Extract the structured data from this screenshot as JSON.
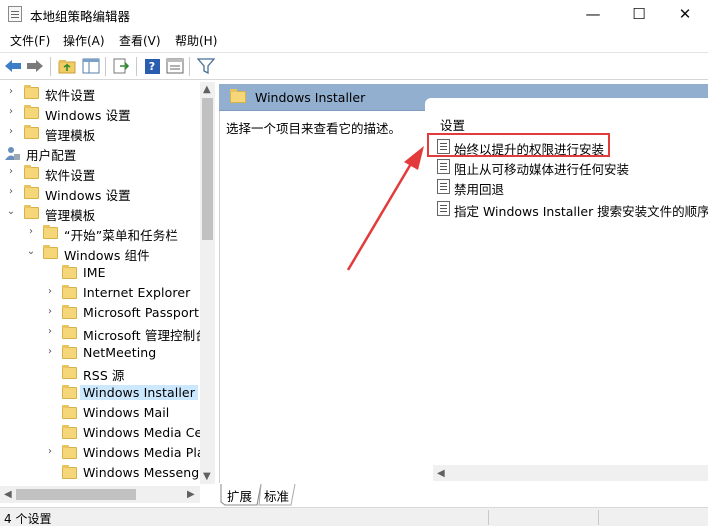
{
  "window": {
    "title": "本地组策略编辑器",
    "minimize_glyph": "—",
    "maximize_glyph": "☐",
    "close_glyph": "✕"
  },
  "menu": [
    "文件(F)",
    "操作(A)",
    "查看(V)",
    "帮助(H)"
  ],
  "toolbar": {
    "icons": [
      "back-arrow-icon",
      "forward-arrow-icon",
      "up-folder-icon",
      "show-hide-tree-icon",
      "export-list-icon",
      "help-icon",
      "properties-icon",
      "filter-icon"
    ],
    "help_glyph": "?"
  },
  "tree": {
    "items": [
      {
        "label": "软件设置",
        "expander": "›"
      },
      {
        "label": "Windows 设置",
        "expander": "›"
      },
      {
        "label": "管理模板",
        "expander": "›"
      },
      {
        "label": "用户配置",
        "expander": "⌄"
      },
      {
        "label": "软件设置",
        "expander": "›"
      },
      {
        "label": "Windows 设置",
        "expander": "›"
      },
      {
        "label": "管理模板",
        "expander": "⌄"
      },
      {
        "label": "“开始”菜单和任务栏",
        "expander": "›"
      },
      {
        "label": "Windows 组件",
        "expander": "⌄"
      },
      {
        "label": "IME",
        "expander": ""
      },
      {
        "label": "Internet Explorer",
        "expander": "›"
      },
      {
        "label": "Microsoft Passport",
        "expander": "›"
      },
      {
        "label": "Microsoft 管理控制台",
        "expander": "›"
      },
      {
        "label": "NetMeeting",
        "expander": "›"
      },
      {
        "label": "RSS 源",
        "expander": ""
      },
      {
        "label": "Windows Installer",
        "expander": ""
      },
      {
        "label": "Windows Mail",
        "expander": ""
      },
      {
        "label": "Windows Media Ce",
        "expander": ""
      },
      {
        "label": "Windows Media Pla",
        "expander": "›"
      },
      {
        "label": "Windows Messenge",
        "expander": ""
      }
    ],
    "selected": "Windows Installer"
  },
  "right_pane": {
    "header_title": "Windows Installer",
    "description": "选择一个项目来查看它的描述。",
    "settings_header": "设置",
    "settings": [
      "始终以提升的权限进行安装",
      "阻止从可移动媒体进行任何安装",
      "禁用回退",
      "指定 Windows Installer 搜索安装文件的顺序"
    ],
    "highlighted_setting": "始终以提升的权限进行安装",
    "annotation_color": "#e33b3b"
  },
  "tabs": [
    "扩展",
    "标准"
  ],
  "status": {
    "text": "4 个设置"
  },
  "colors": {
    "header_bg": "#93afd0",
    "selection_bg": "#cce8ff",
    "folder": "#f5d77a"
  }
}
